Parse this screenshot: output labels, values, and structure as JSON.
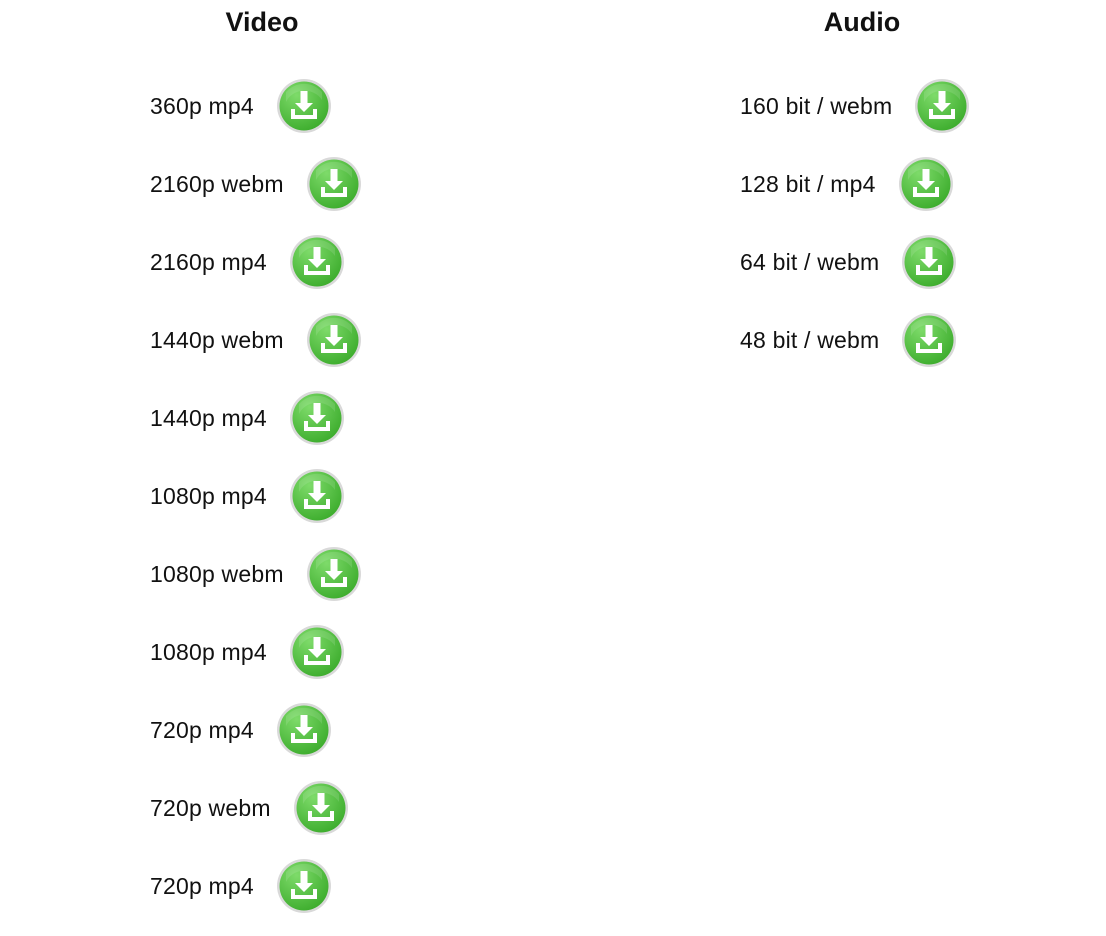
{
  "video": {
    "title": "Video",
    "items": [
      {
        "label": "360p mp4"
      },
      {
        "label": "2160p webm"
      },
      {
        "label": "2160p mp4"
      },
      {
        "label": "1440p webm"
      },
      {
        "label": "1440p mp4"
      },
      {
        "label": "1080p mp4"
      },
      {
        "label": "1080p webm"
      },
      {
        "label": "1080p mp4"
      },
      {
        "label": "720p mp4"
      },
      {
        "label": "720p webm"
      },
      {
        "label": "720p mp4"
      }
    ]
  },
  "audio": {
    "title": "Audio",
    "items": [
      {
        "label": "160 bit / webm"
      },
      {
        "label": "128 bit / mp4"
      },
      {
        "label": "64 bit / webm"
      },
      {
        "label": "48 bit / webm"
      }
    ]
  },
  "download_icon": "download-arrow-icon",
  "colors": {
    "button_green_light": "#7edb6a",
    "button_green_dark": "#3fae2f",
    "button_ring": "#d9d9d9",
    "icon_white": "#ffffff"
  }
}
